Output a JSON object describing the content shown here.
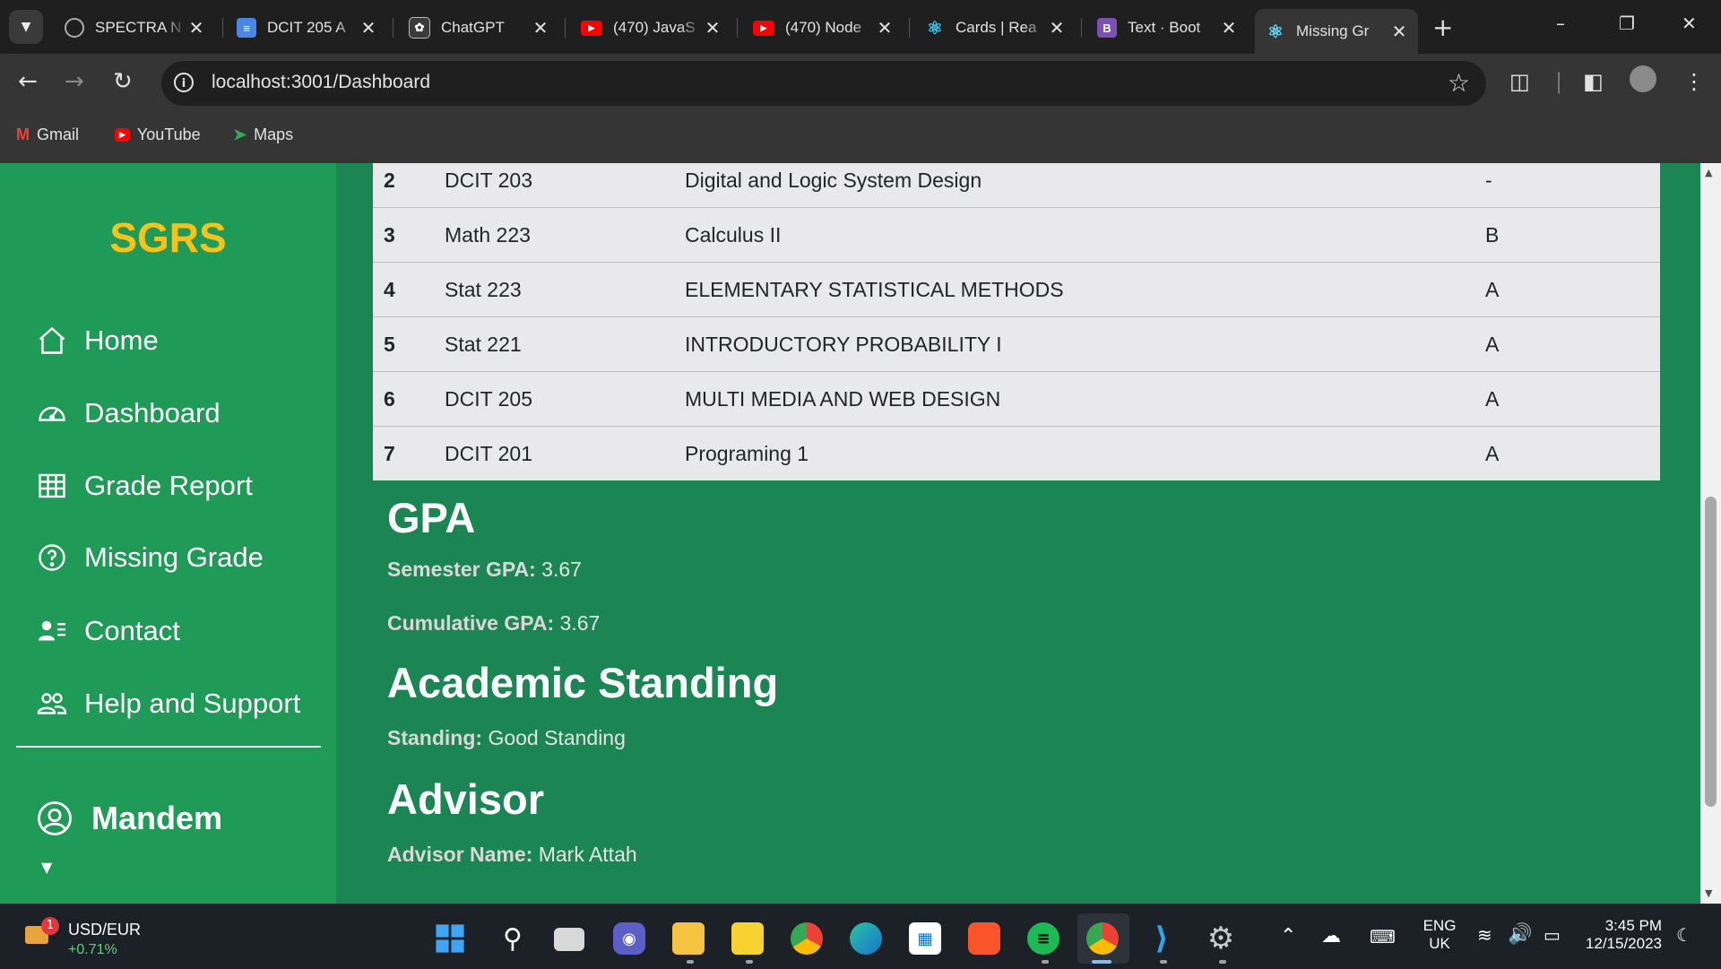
{
  "browser": {
    "tabs": [
      {
        "label": "SPECTRA N",
        "icon": "spectra-favicon"
      },
      {
        "label": "DCIT 205 A",
        "icon": "google-docs-favicon"
      },
      {
        "label": "ChatGPT",
        "icon": "chatgpt-favicon"
      },
      {
        "label": "(470) JavaS",
        "icon": "youtube-favicon"
      },
      {
        "label": "(470) Node",
        "icon": "youtube-favicon"
      },
      {
        "label": "Cards | Rea",
        "icon": "react-favicon"
      },
      {
        "label": "Text · Boot",
        "icon": "bootstrap-favicon"
      },
      {
        "label": "Missing Gr",
        "icon": "react-favicon",
        "active": true
      }
    ],
    "url": "localhost:3001/Dashboard",
    "bookmarks": [
      {
        "label": "Gmail"
      },
      {
        "label": "YouTube"
      },
      {
        "label": "Maps"
      }
    ]
  },
  "sidebar": {
    "brand": "SGRS",
    "items": [
      {
        "label": "Home"
      },
      {
        "label": "Dashboard"
      },
      {
        "label": "Grade Report"
      },
      {
        "label": "Missing Grade"
      },
      {
        "label": "Contact"
      },
      {
        "label": "Help and Support"
      }
    ],
    "user": "Mandem"
  },
  "grades": {
    "rows": [
      {
        "num": "2",
        "code": "DCIT 203",
        "title": "Digital and Logic System Design",
        "grade": "-"
      },
      {
        "num": "3",
        "code": "Math 223",
        "title": "Calculus II",
        "grade": "B"
      },
      {
        "num": "4",
        "code": "Stat 223",
        "title": "ELEMENTARY STATISTICAL METHODS",
        "grade": "A"
      },
      {
        "num": "5",
        "code": "Stat 221",
        "title": "INTRODUCTORY PROBABILITY I",
        "grade": "A"
      },
      {
        "num": "6",
        "code": "DCIT 205",
        "title": "MULTI MEDIA AND WEB DESIGN",
        "grade": "A"
      },
      {
        "num": "7",
        "code": "DCIT 201",
        "title": "Programing 1",
        "grade": "A"
      }
    ]
  },
  "gpa": {
    "heading": "GPA",
    "semester_label": "Semester GPA:",
    "semester_value": "3.67",
    "cumulative_label": "Cumulative GPA:",
    "cumulative_value": "3.67"
  },
  "standing": {
    "heading": "Academic Standing",
    "label": "Standing:",
    "value": "Good Standing"
  },
  "advisor": {
    "heading": "Advisor",
    "name_label": "Advisor Name:",
    "name_value": "Mark Attah"
  },
  "taskbar": {
    "widget_title": "USD/EUR",
    "widget_change": "+0.71%",
    "widget_badge": "1",
    "lang_line1": "ENG",
    "lang_line2": "UK",
    "time": "3:45 PM",
    "date": "12/15/2023"
  },
  "colors": {
    "sidebar_bg": "#1f9a57",
    "main_bg": "#1b8553",
    "brand": "#f8c21a"
  }
}
